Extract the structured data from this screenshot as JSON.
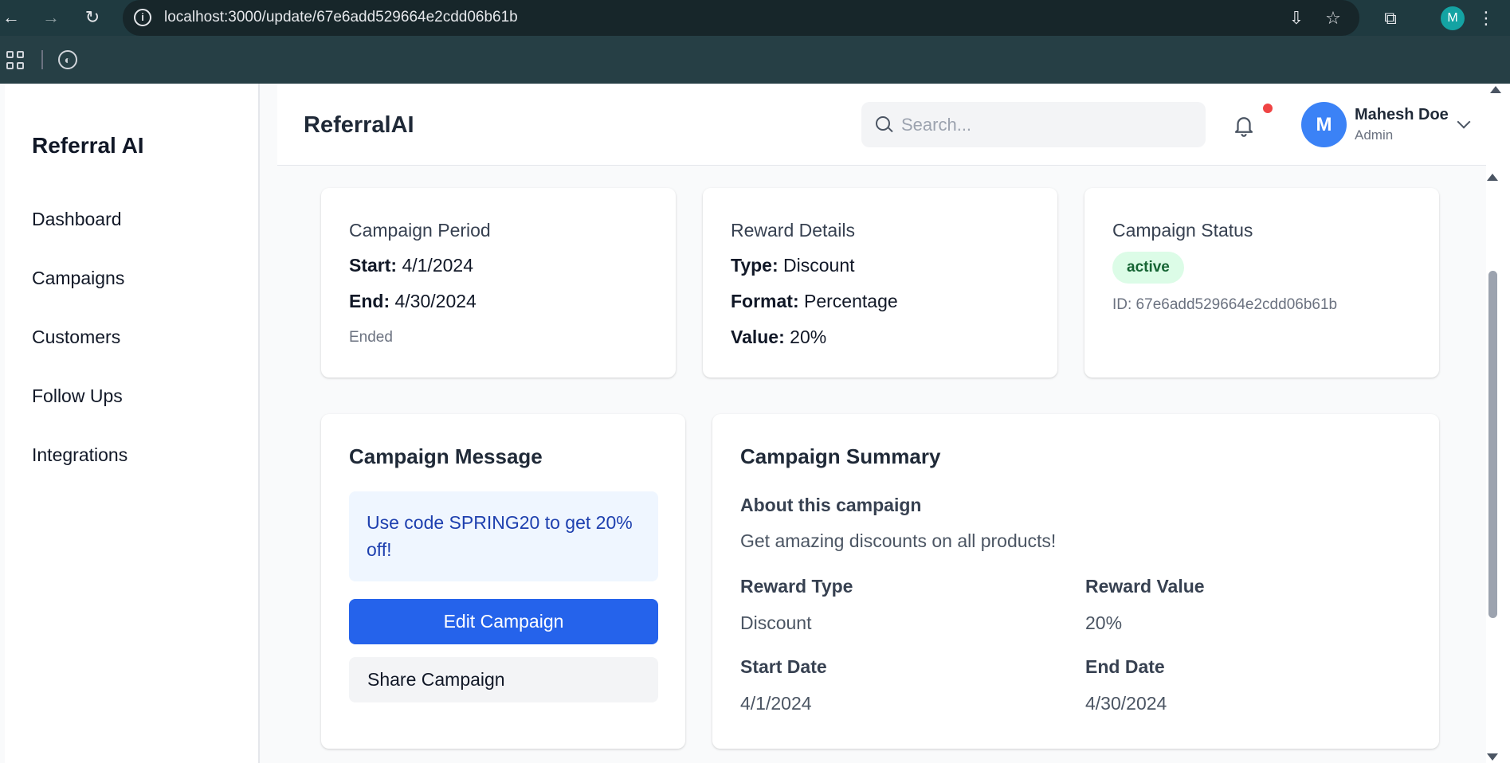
{
  "browser": {
    "url": "localhost:3000/update/67e6add529664e2cdd06b61b",
    "profile_initial": "M"
  },
  "sidebar": {
    "brand": "Referral AI",
    "items": [
      {
        "label": "Dashboard"
      },
      {
        "label": "Campaigns"
      },
      {
        "label": "Customers"
      },
      {
        "label": "Follow Ups"
      },
      {
        "label": "Integrations"
      }
    ]
  },
  "header": {
    "title": "ReferralAI",
    "search_placeholder": "Search...",
    "user": {
      "initial": "M",
      "name": "Mahesh Doe",
      "role": "Admin"
    }
  },
  "period_card": {
    "heading": "Campaign Period",
    "start_label": "Start:",
    "start_value": "4/1/2024",
    "end_label": "End:",
    "end_value": "4/30/2024",
    "status_note": "Ended"
  },
  "reward_card": {
    "heading": "Reward Details",
    "type_label": "Type:",
    "type_value": "Discount",
    "format_label": "Format:",
    "format_value": "Percentage",
    "value_label": "Value:",
    "value_value": "20%"
  },
  "status_card": {
    "heading": "Campaign Status",
    "badge": "active",
    "id_text": "ID: 67e6add529664e2cdd06b61b",
    "badge_color": "#dcfce7"
  },
  "message_card": {
    "title": "Campaign Message",
    "message": "Use code SPRING20 to get 20% off!",
    "edit_button": "Edit Campaign",
    "share_button": "Share Campaign"
  },
  "summary_card": {
    "title": "Campaign Summary",
    "about_label": "About this campaign",
    "about_text": "Get amazing discounts on all products!",
    "reward_type_label": "Reward Type",
    "reward_type_value": "Discount",
    "reward_value_label": "Reward Value",
    "reward_value_value": "20%",
    "start_label": "Start Date",
    "start_value": "4/1/2024",
    "end_label": "End Date",
    "end_value": "4/30/2024"
  },
  "colors": {
    "primary": "#2563eb",
    "chrome": "#1f3a40",
    "notification": "#ef4444",
    "avatar": "#3b82f6"
  }
}
